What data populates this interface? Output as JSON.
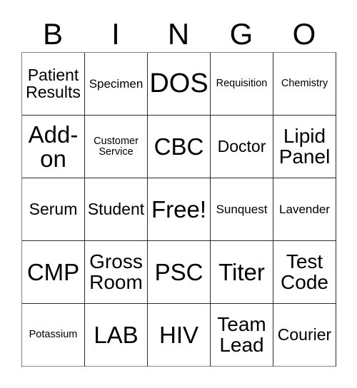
{
  "card": {
    "title": "BINGO",
    "header_letters": [
      "B",
      "I",
      "N",
      "G",
      "O"
    ],
    "free_space_label": "Free!",
    "colors": {
      "background": "#ffffff",
      "text": "#000000",
      "grid_line": "#2b2b2b",
      "grid_outer_line": "#808080"
    },
    "grid": {
      "columns": 5,
      "rows": 5,
      "cells": [
        {
          "text": "Patient\nResults",
          "size": "fs-md",
          "name": "bingo-cell-patient-results"
        },
        {
          "text": "Specimen",
          "size": "fs-sm",
          "name": "bingo-cell-specimen"
        },
        {
          "text": "DOS",
          "size": "fs-xxl",
          "name": "bingo-cell-dos"
        },
        {
          "text": "Requisition",
          "size": "fs-xs",
          "name": "bingo-cell-requisition"
        },
        {
          "text": "Chemistry",
          "size": "fs-xs",
          "name": "bingo-cell-chemistry"
        },
        {
          "text": "Add-\non",
          "size": "fs-xl",
          "name": "bingo-cell-add-on"
        },
        {
          "text": "Customer\nService",
          "size": "fs-xs",
          "name": "bingo-cell-customer-service"
        },
        {
          "text": "CBC",
          "size": "fs-xl",
          "name": "bingo-cell-cbc"
        },
        {
          "text": "Doctor",
          "size": "fs-md",
          "name": "bingo-cell-doctor"
        },
        {
          "text": "Lipid\nPanel",
          "size": "fs-lg",
          "name": "bingo-cell-lipid-panel"
        },
        {
          "text": "Serum",
          "size": "fs-md",
          "name": "bingo-cell-serum"
        },
        {
          "text": "Student",
          "size": "fs-md",
          "name": "bingo-cell-student"
        },
        {
          "text": "Free!",
          "size": "fs-xl",
          "name": "bingo-cell-free-space"
        },
        {
          "text": "Sunquest",
          "size": "fs-sm",
          "name": "bingo-cell-sunquest"
        },
        {
          "text": "Lavender",
          "size": "fs-sm",
          "name": "bingo-cell-lavender"
        },
        {
          "text": "CMP",
          "size": "fs-xl",
          "name": "bingo-cell-cmp"
        },
        {
          "text": "Gross\nRoom",
          "size": "fs-lg",
          "name": "bingo-cell-gross-room"
        },
        {
          "text": "PSC",
          "size": "fs-xl",
          "name": "bingo-cell-psc"
        },
        {
          "text": "Titer",
          "size": "fs-xl",
          "name": "bingo-cell-titer"
        },
        {
          "text": "Test\nCode",
          "size": "fs-lg",
          "name": "bingo-cell-test-code"
        },
        {
          "text": "Potassium",
          "size": "fs-xs",
          "name": "bingo-cell-potassium"
        },
        {
          "text": "LAB",
          "size": "fs-xl",
          "name": "bingo-cell-lab"
        },
        {
          "text": "HIV",
          "size": "fs-xl",
          "name": "bingo-cell-hiv"
        },
        {
          "text": "Team\nLead",
          "size": "fs-lg",
          "name": "bingo-cell-team-lead"
        },
        {
          "text": "Courier",
          "size": "fs-md",
          "name": "bingo-cell-courier"
        }
      ]
    }
  }
}
